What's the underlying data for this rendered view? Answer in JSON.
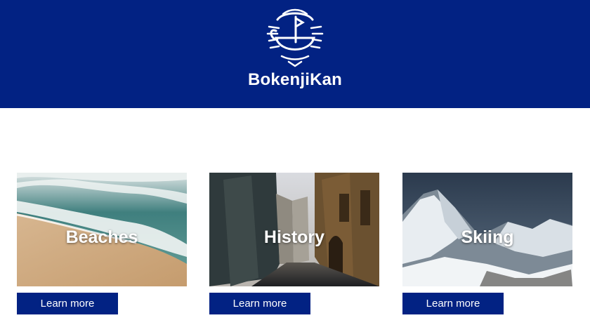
{
  "header": {
    "brand": "BokenjiKan",
    "logo_icon": "boat-sun-waves-logo-icon",
    "background_color": "#022283"
  },
  "cards": [
    {
      "title": "Beaches",
      "button_label": "Learn more",
      "image": "beach-waves-photo"
    },
    {
      "title": "History",
      "button_label": "Learn more",
      "image": "old-town-street-photo"
    },
    {
      "title": "Skiing",
      "button_label": "Learn more",
      "image": "snowy-mountains-photo"
    }
  ],
  "colors": {
    "primary": "#022283",
    "text_on_primary": "#ffffff"
  }
}
